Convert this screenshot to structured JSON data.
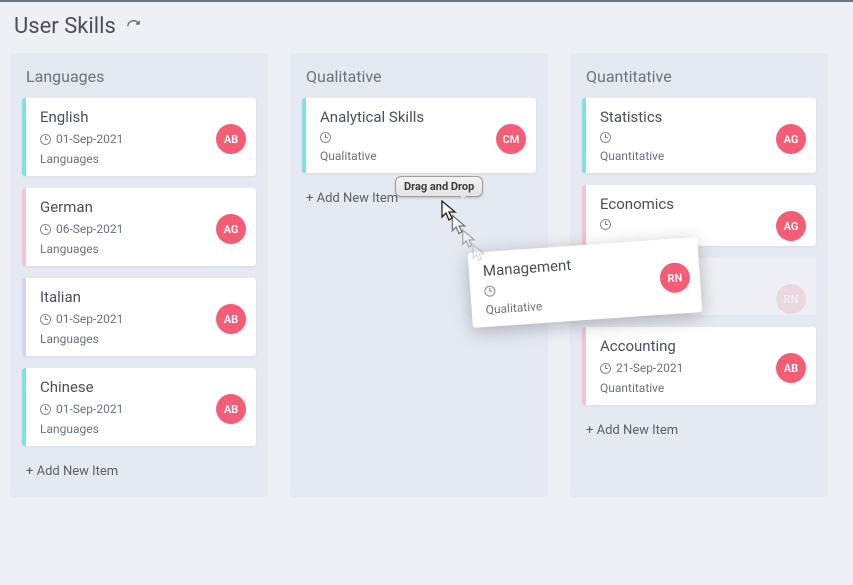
{
  "header": {
    "title": "User Skills"
  },
  "addLabel": "+ Add New Item",
  "tooltip": "Drag and Drop",
  "columns": [
    {
      "title": "Languages",
      "cards": [
        {
          "title": "English",
          "date": "01-Sep-2021",
          "category": "Languages",
          "initials": "AB",
          "color": "teal"
        },
        {
          "title": "German",
          "date": "06-Sep-2021",
          "category": "Languages",
          "initials": "AG",
          "color": "pink"
        },
        {
          "title": "Italian",
          "date": "01-Sep-2021",
          "category": "Languages",
          "initials": "AB",
          "color": "lav"
        },
        {
          "title": "Chinese",
          "date": "01-Sep-2021",
          "category": "Languages",
          "initials": "AB",
          "color": "teal"
        }
      ]
    },
    {
      "title": "Qualitative",
      "cards": [
        {
          "title": "Analytical Skills",
          "date": "",
          "category": "Qualitative",
          "initials": "CM",
          "color": "teal"
        }
      ]
    },
    {
      "title": "Quantitative",
      "cards": [
        {
          "title": "Statistics",
          "date": "",
          "category": "Quantitative",
          "initials": "AG",
          "color": "teal"
        },
        {
          "title": "Economics",
          "date": "",
          "category": "",
          "initials": "AG",
          "color": "pink"
        },
        {
          "title": "",
          "date": "",
          "category": "Qualitative",
          "initials": "RN",
          "color": "ghost"
        },
        {
          "title": "Accounting",
          "date": "21-Sep-2021",
          "category": "Quantitative",
          "initials": "AB",
          "color": "pink"
        }
      ]
    }
  ],
  "dragCard": {
    "title": "Management",
    "date": "",
    "category": "Qualitative",
    "initials": "RN"
  }
}
